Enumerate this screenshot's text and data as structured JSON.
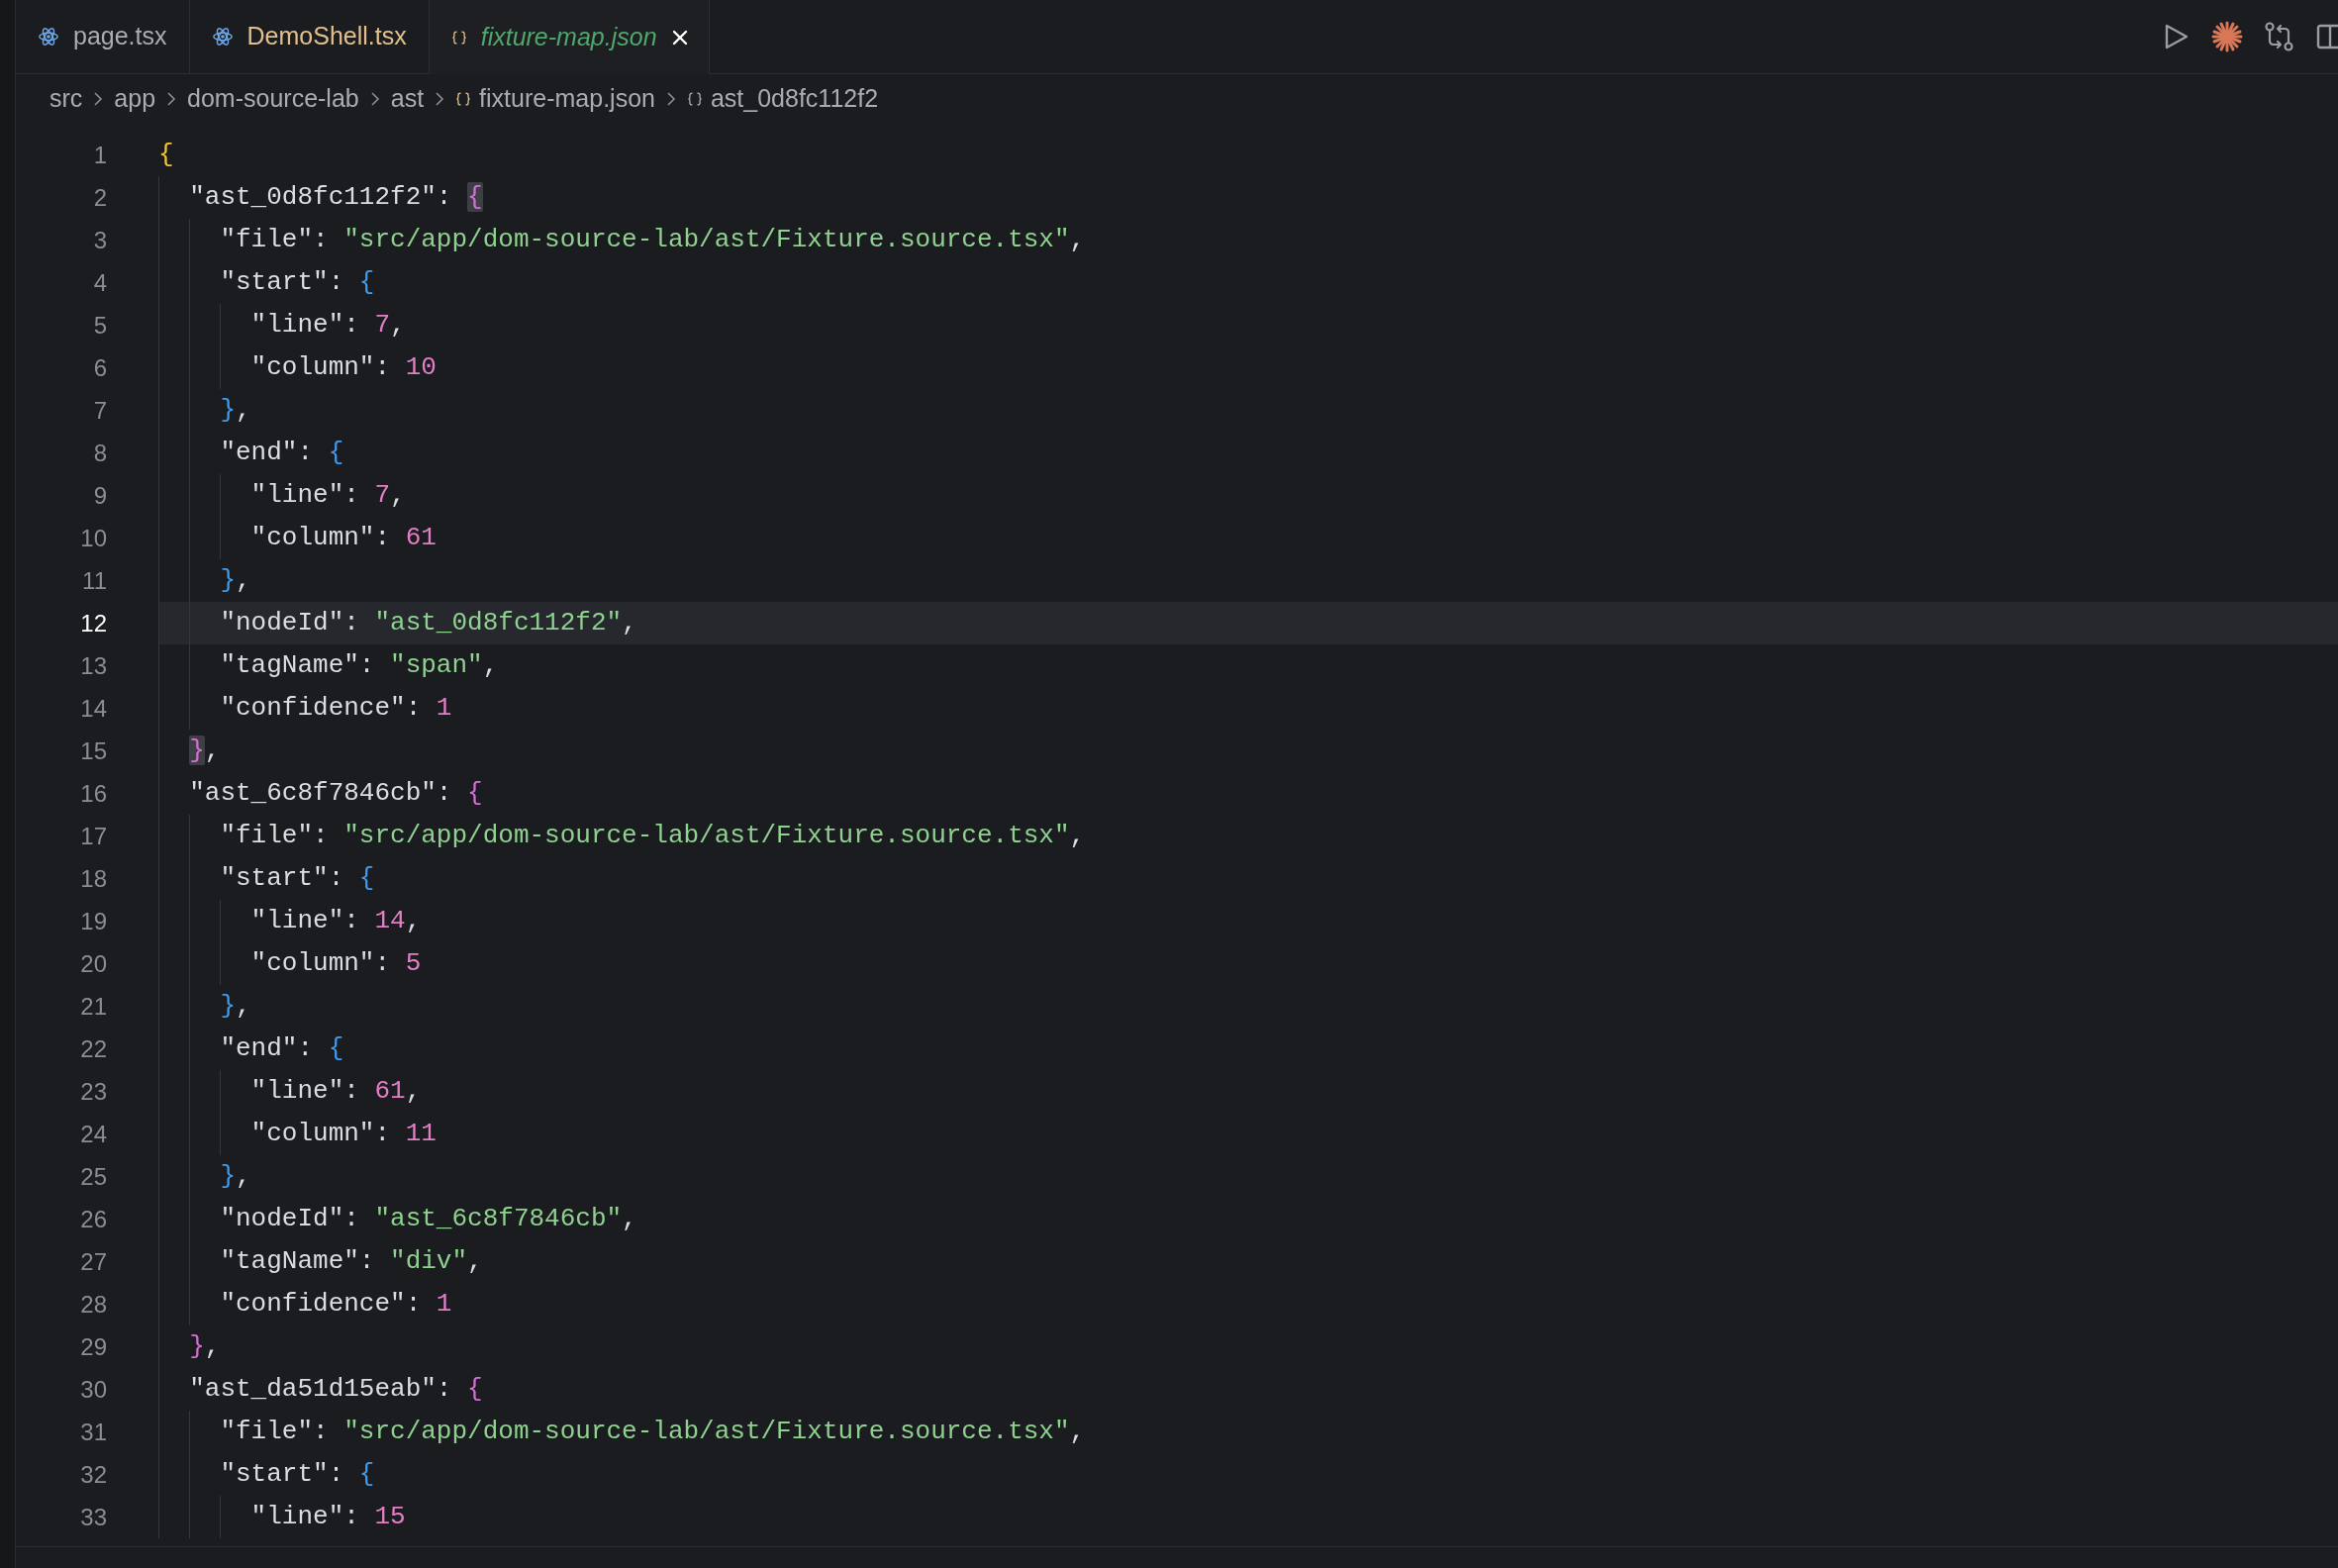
{
  "tabs": [
    {
      "label": "page.tsx",
      "kind": "component",
      "color": "#a9acb2",
      "selected": false,
      "preview": false
    },
    {
      "label": "DemoShell.tsx",
      "kind": "component",
      "color": "#e2c08d",
      "selected": false,
      "preview": false
    },
    {
      "label": "fixture-map.json",
      "kind": "data",
      "color": "#4fa86b",
      "selected": true,
      "preview": true
    }
  ],
  "breadcrumbs": [
    {
      "text": "src",
      "kind": "folder"
    },
    {
      "text": "app",
      "kind": "folder"
    },
    {
      "text": "dom-source-lab",
      "kind": "folder"
    },
    {
      "text": "ast",
      "kind": "folder"
    },
    {
      "text": "fixture-map.json",
      "kind": "file"
    },
    {
      "text": "ast_0d8fc112f2",
      "kind": "symbol"
    }
  ],
  "lines": [
    {
      "number": "1",
      "selected": false,
      "tokens": [
        {
          "text": "{",
          "kind": "rootbrace",
          "matched": false
        }
      ]
    },
    {
      "number": "2",
      "selected": false,
      "tokens": [
        {
          "text": "  \"ast_0d8fc112f2\"",
          "kind": "key"
        },
        {
          "text": ": ",
          "kind": "punct"
        },
        {
          "text": "{",
          "kind": "entrybrace",
          "matched": true
        }
      ]
    },
    {
      "number": "3",
      "selected": false,
      "tokens": [
        {
          "text": "    \"file\"",
          "kind": "key"
        },
        {
          "text": ": ",
          "kind": "punct"
        },
        {
          "text": "\"src/app/dom-source-lab/ast/Fixture.source.tsx\"",
          "kind": "string"
        },
        {
          "text": ",",
          "kind": "punct"
        }
      ]
    },
    {
      "number": "4",
      "selected": false,
      "tokens": [
        {
          "text": "    \"start\"",
          "kind": "key"
        },
        {
          "text": ": ",
          "kind": "punct"
        },
        {
          "text": "{",
          "kind": "fieldbrace",
          "matched": false
        }
      ]
    },
    {
      "number": "5",
      "selected": false,
      "tokens": [
        {
          "text": "      \"line\"",
          "kind": "key"
        },
        {
          "text": ": ",
          "kind": "punct"
        },
        {
          "text": "7",
          "kind": "number"
        },
        {
          "text": ",",
          "kind": "punct"
        }
      ]
    },
    {
      "number": "6",
      "selected": false,
      "tokens": [
        {
          "text": "      \"column\"",
          "kind": "key"
        },
        {
          "text": ": ",
          "kind": "punct"
        },
        {
          "text": "10",
          "kind": "number"
        }
      ]
    },
    {
      "number": "7",
      "selected": false,
      "tokens": [
        {
          "text": "    }",
          "kind": "fieldbrace",
          "matched": false
        },
        {
          "text": ",",
          "kind": "punct"
        }
      ]
    },
    {
      "number": "8",
      "selected": false,
      "tokens": [
        {
          "text": "    \"end\"",
          "kind": "key"
        },
        {
          "text": ": ",
          "kind": "punct"
        },
        {
          "text": "{",
          "kind": "fieldbrace",
          "matched": false
        }
      ]
    },
    {
      "number": "9",
      "selected": false,
      "tokens": [
        {
          "text": "      \"line\"",
          "kind": "key"
        },
        {
          "text": ": ",
          "kind": "punct"
        },
        {
          "text": "7",
          "kind": "number"
        },
        {
          "text": ",",
          "kind": "punct"
        }
      ]
    },
    {
      "number": "10",
      "selected": false,
      "tokens": [
        {
          "text": "      \"column\"",
          "kind": "key"
        },
        {
          "text": ": ",
          "kind": "punct"
        },
        {
          "text": "61",
          "kind": "number"
        }
      ]
    },
    {
      "number": "11",
      "selected": false,
      "tokens": [
        {
          "text": "    }",
          "kind": "fieldbrace",
          "matched": false
        },
        {
          "text": ",",
          "kind": "punct"
        }
      ]
    },
    {
      "number": "12",
      "selected": true,
      "tokens": [
        {
          "text": "    \"nodeId\"",
          "kind": "key"
        },
        {
          "text": ": ",
          "kind": "punct"
        },
        {
          "text": "\"ast_0d8fc112f2\"",
          "kind": "string"
        },
        {
          "text": ",",
          "kind": "punct"
        }
      ]
    },
    {
      "number": "13",
      "selected": false,
      "tokens": [
        {
          "text": "    \"tagName\"",
          "kind": "key"
        },
        {
          "text": ": ",
          "kind": "punct"
        },
        {
          "text": "\"span\"",
          "kind": "string"
        },
        {
          "text": ",",
          "kind": "punct"
        }
      ]
    },
    {
      "number": "14",
      "selected": false,
      "tokens": [
        {
          "text": "    \"confidence\"",
          "kind": "key"
        },
        {
          "text": ": ",
          "kind": "punct"
        },
        {
          "text": "1",
          "kind": "number"
        }
      ]
    },
    {
      "number": "15",
      "selected": false,
      "tokens": [
        {
          "text": "  }",
          "kind": "entrybrace",
          "matched": true
        },
        {
          "text": ",",
          "kind": "punct"
        }
      ]
    },
    {
      "number": "16",
      "selected": false,
      "tokens": [
        {
          "text": "  \"ast_6c8f7846cb\"",
          "kind": "key"
        },
        {
          "text": ": ",
          "kind": "punct"
        },
        {
          "text": "{",
          "kind": "entrybrace",
          "matched": false
        }
      ]
    },
    {
      "number": "17",
      "selected": false,
      "tokens": [
        {
          "text": "    \"file\"",
          "kind": "key"
        },
        {
          "text": ": ",
          "kind": "punct"
        },
        {
          "text": "\"src/app/dom-source-lab/ast/Fixture.source.tsx\"",
          "kind": "string"
        },
        {
          "text": ",",
          "kind": "punct"
        }
      ]
    },
    {
      "number": "18",
      "selected": false,
      "tokens": [
        {
          "text": "    \"start\"",
          "kind": "key"
        },
        {
          "text": ": ",
          "kind": "punct"
        },
        {
          "text": "{",
          "kind": "fieldbrace",
          "matched": false
        }
      ]
    },
    {
      "number": "19",
      "selected": false,
      "tokens": [
        {
          "text": "      \"line\"",
          "kind": "key"
        },
        {
          "text": ": ",
          "kind": "punct"
        },
        {
          "text": "14",
          "kind": "number"
        },
        {
          "text": ",",
          "kind": "punct"
        }
      ]
    },
    {
      "number": "20",
      "selected": false,
      "tokens": [
        {
          "text": "      \"column\"",
          "kind": "key"
        },
        {
          "text": ": ",
          "kind": "punct"
        },
        {
          "text": "5",
          "kind": "number"
        }
      ]
    },
    {
      "number": "21",
      "selected": false,
      "tokens": [
        {
          "text": "    }",
          "kind": "fieldbrace",
          "matched": false
        },
        {
          "text": ",",
          "kind": "punct"
        }
      ]
    },
    {
      "number": "22",
      "selected": false,
      "tokens": [
        {
          "text": "    \"end\"",
          "kind": "key"
        },
        {
          "text": ": ",
          "kind": "punct"
        },
        {
          "text": "{",
          "kind": "fieldbrace",
          "matched": false
        }
      ]
    },
    {
      "number": "23",
      "selected": false,
      "tokens": [
        {
          "text": "      \"line\"",
          "kind": "key"
        },
        {
          "text": ": ",
          "kind": "punct"
        },
        {
          "text": "61",
          "kind": "number"
        },
        {
          "text": ",",
          "kind": "punct"
        }
      ]
    },
    {
      "number": "24",
      "selected": false,
      "tokens": [
        {
          "text": "      \"column\"",
          "kind": "key"
        },
        {
          "text": ": ",
          "kind": "punct"
        },
        {
          "text": "11",
          "kind": "number"
        }
      ]
    },
    {
      "number": "25",
      "selected": false,
      "tokens": [
        {
          "text": "    }",
          "kind": "fieldbrace",
          "matched": false
        },
        {
          "text": ",",
          "kind": "punct"
        }
      ]
    },
    {
      "number": "26",
      "selected": false,
      "tokens": [
        {
          "text": "    \"nodeId\"",
          "kind": "key"
        },
        {
          "text": ": ",
          "kind": "punct"
        },
        {
          "text": "\"ast_6c8f7846cb\"",
          "kind": "string"
        },
        {
          "text": ",",
          "kind": "punct"
        }
      ]
    },
    {
      "number": "27",
      "selected": false,
      "tokens": [
        {
          "text": "    \"tagName\"",
          "kind": "key"
        },
        {
          "text": ": ",
          "kind": "punct"
        },
        {
          "text": "\"div\"",
          "kind": "string"
        },
        {
          "text": ",",
          "kind": "punct"
        }
      ]
    },
    {
      "number": "28",
      "selected": false,
      "tokens": [
        {
          "text": "    \"confidence\"",
          "kind": "key"
        },
        {
          "text": ": ",
          "kind": "punct"
        },
        {
          "text": "1",
          "kind": "number"
        }
      ]
    },
    {
      "number": "29",
      "selected": false,
      "tokens": [
        {
          "text": "  }",
          "kind": "entrybrace",
          "matched": false
        },
        {
          "text": ",",
          "kind": "punct"
        }
      ]
    },
    {
      "number": "30",
      "selected": false,
      "tokens": [
        {
          "text": "  \"ast_da51d15eab\"",
          "kind": "key"
        },
        {
          "text": ": ",
          "kind": "punct"
        },
        {
          "text": "{",
          "kind": "entrybrace",
          "matched": false
        }
      ]
    },
    {
      "number": "31",
      "selected": false,
      "tokens": [
        {
          "text": "    \"file\"",
          "kind": "key"
        },
        {
          "text": ": ",
          "kind": "punct"
        },
        {
          "text": "\"src/app/dom-source-lab/ast/Fixture.source.tsx\"",
          "kind": "string"
        },
        {
          "text": ",",
          "kind": "punct"
        }
      ]
    },
    {
      "number": "32",
      "selected": false,
      "tokens": [
        {
          "text": "    \"start\"",
          "kind": "key"
        },
        {
          "text": ": ",
          "kind": "punct"
        },
        {
          "text": "{",
          "kind": "fieldbrace",
          "matched": false
        }
      ]
    },
    {
      "number": "33",
      "selected": false,
      "tokens": [
        {
          "text": "      \"line\"",
          "kind": "key"
        },
        {
          "text": ": ",
          "kind": "punct"
        },
        {
          "text": "15",
          "kind": "number"
        }
      ]
    }
  ]
}
